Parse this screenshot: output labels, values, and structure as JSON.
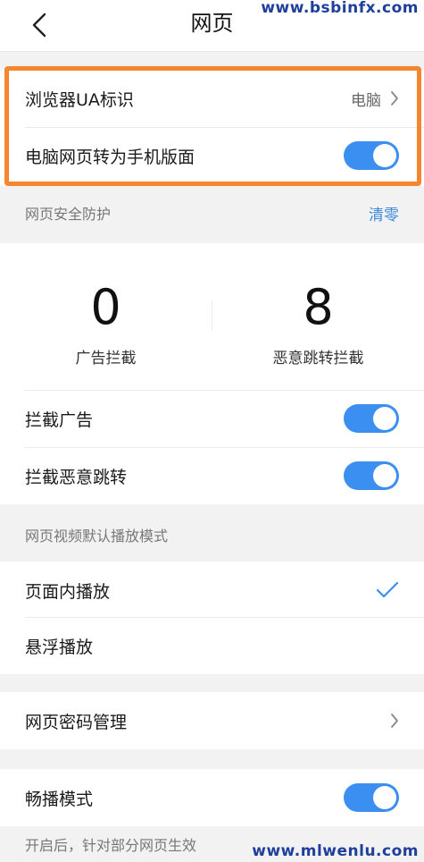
{
  "header": {
    "title": "网页",
    "watermark_top": "www.bsbinfx.com",
    "watermark_bottom": "www.mlwenlu.com"
  },
  "browser_ua": {
    "label": "浏览器UA标识",
    "value": "电脑"
  },
  "desktop_to_mobile": {
    "label": "电脑网页转为手机版面",
    "enabled": true
  },
  "security": {
    "section_title": "网页安全防护",
    "reset_label": "清零",
    "stats": [
      {
        "value": "0",
        "label": "广告拦截"
      },
      {
        "value": "8",
        "label": "恶意跳转拦截"
      }
    ],
    "block_ads": {
      "label": "拦截广告",
      "enabled": true
    },
    "block_redirect": {
      "label": "拦截恶意跳转",
      "enabled": true
    }
  },
  "video_mode": {
    "section_title": "网页视频默认播放模式",
    "options": [
      {
        "label": "页面内播放",
        "selected": true
      },
      {
        "label": "悬浮播放",
        "selected": false
      }
    ]
  },
  "password_manager": {
    "label": "网页密码管理"
  },
  "smooth_mode": {
    "label": "畅播模式",
    "enabled": true,
    "note": "开启后，针对部分网页生效"
  },
  "colors": {
    "accent": "#3b8ff0",
    "highlight": "#f5862e",
    "link": "#3d8bd9"
  }
}
